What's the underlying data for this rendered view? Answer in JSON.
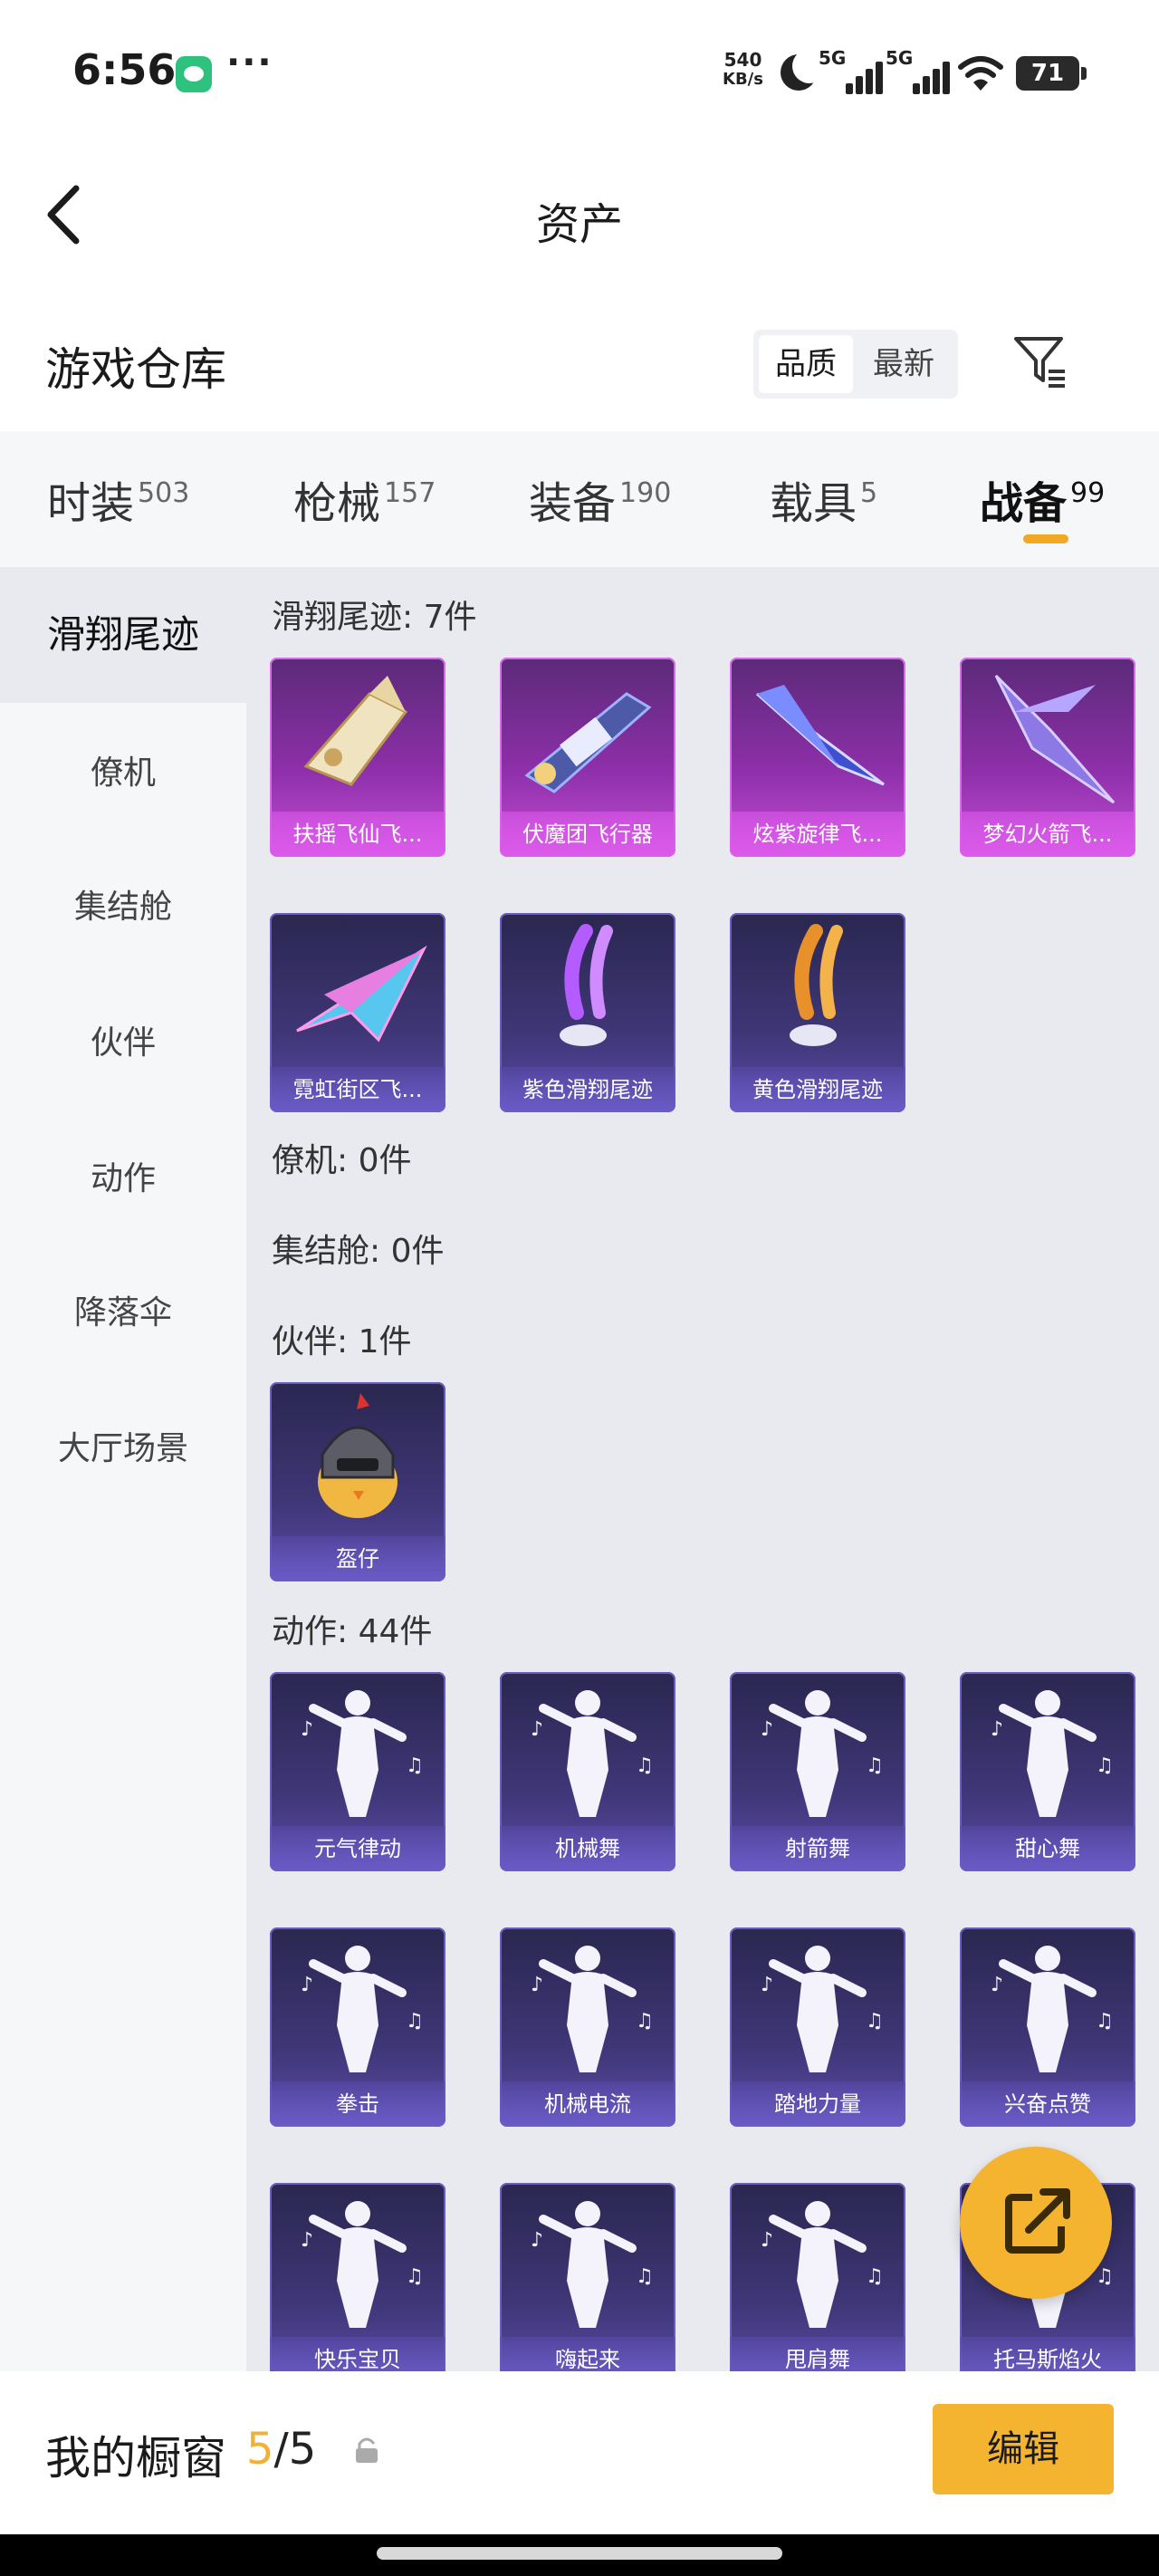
{
  "status": {
    "time": "6:56",
    "speed_value": "540",
    "speed_unit": "KB/s",
    "net1": "5G",
    "net2": "5G",
    "battery": "71"
  },
  "header": {
    "title": "资产"
  },
  "warehouse": {
    "title": "游戏仓库",
    "sort_options": [
      "品质",
      "最新"
    ],
    "active_sort": "品质"
  },
  "tabs": [
    {
      "label": "时装",
      "count": "503"
    },
    {
      "label": "枪械",
      "count": "157"
    },
    {
      "label": "装备",
      "count": "190"
    },
    {
      "label": "载具",
      "count": "5"
    },
    {
      "label": "战备",
      "count": "99",
      "active": true
    }
  ],
  "sidebar": [
    {
      "label": "滑翔尾迹",
      "active": true
    },
    {
      "label": "僚机"
    },
    {
      "label": "集结舱"
    },
    {
      "label": "伙伴"
    },
    {
      "label": "动作"
    },
    {
      "label": "降落伞"
    },
    {
      "label": "大厅场景"
    }
  ],
  "sections": {
    "glide": {
      "label": "滑翔尾迹: 7件",
      "items": [
        "扶摇飞仙飞...",
        "伏魔团飞行器",
        "炫紫旋律飞...",
        "梦幻火箭飞...",
        "霓虹街区飞...",
        "紫色滑翔尾迹",
        "黄色滑翔尾迹"
      ]
    },
    "wingman": {
      "label": "僚机: 0件"
    },
    "capsule": {
      "label": "集结舱: 0件"
    },
    "partner": {
      "label": "伙伴: 1件",
      "items": [
        "盔仔"
      ]
    },
    "emote": {
      "label": "动作: 44件",
      "items": [
        "元气律动",
        "机械舞",
        "射箭舞",
        "甜心舞",
        "拳击",
        "机械电流",
        "踏地力量",
        "兴奋点赞",
        "快乐宝贝",
        "嗨起来",
        "甩肩舞",
        "托马斯焰火"
      ]
    }
  },
  "showcase": {
    "label": "我的橱窗",
    "current": "5",
    "total": "/5",
    "edit_label": "编辑"
  },
  "colors": {
    "accent": "#f4b430",
    "legendary_card": "#8c2fa8",
    "epic_card": "#3f3677"
  }
}
